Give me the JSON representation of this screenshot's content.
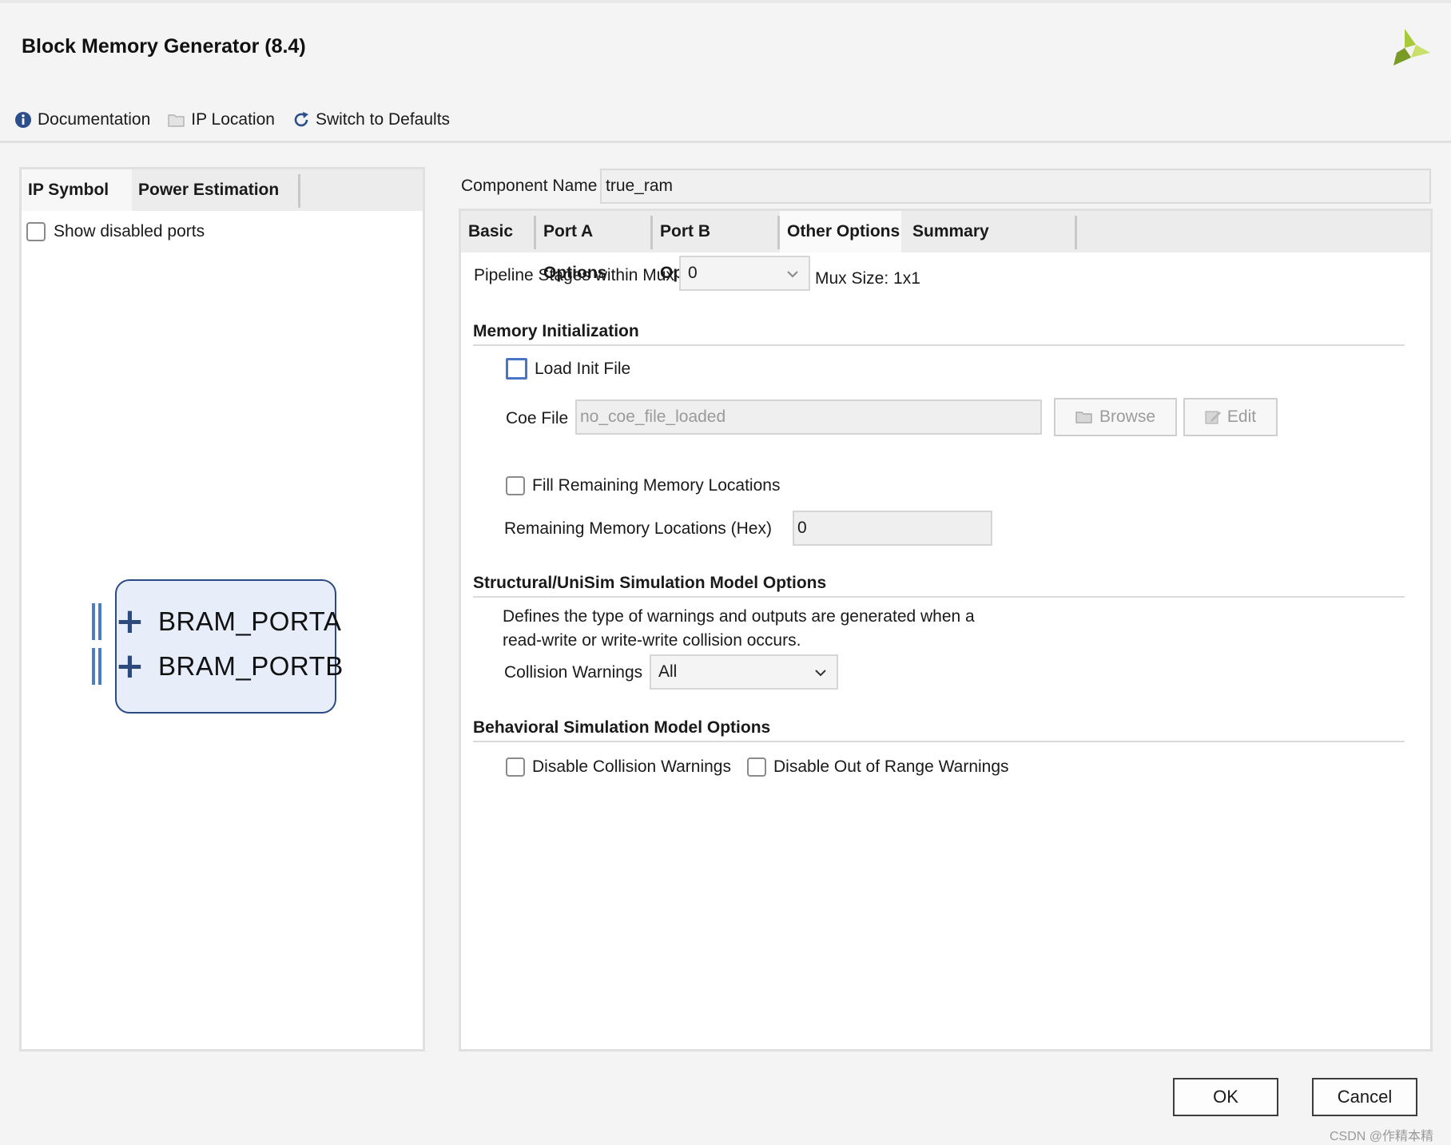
{
  "window": {
    "title": "Block Memory Generator (8.4)"
  },
  "toolbar": {
    "documentation": "Documentation",
    "ip_location": "IP Location",
    "switch_defaults": "Switch to Defaults"
  },
  "left_panel": {
    "tabs": [
      "IP Symbol",
      "Power Estimation"
    ],
    "show_disabled_ports": "Show disabled ports",
    "ports": [
      "BRAM_PORTA",
      "BRAM_PORTB"
    ]
  },
  "component": {
    "label": "Component Name",
    "value": "true_ram"
  },
  "right_tabs": [
    "Basic",
    "Port A Options",
    "Port B Options",
    "Other Options",
    "Summary"
  ],
  "pipeline": {
    "label": "Pipeline Stages within Mux",
    "value": "0",
    "mux_size": "Mux Size: 1x1"
  },
  "memory_init": {
    "heading": "Memory Initialization",
    "load_init": "Load Init File",
    "coe_label": "Coe File",
    "coe_value": "no_coe_file_loaded",
    "browse": "Browse",
    "edit": "Edit",
    "fill_remaining": "Fill Remaining Memory Locations",
    "remaining_label": "Remaining Memory Locations (Hex)",
    "remaining_value": "0"
  },
  "structural": {
    "heading": "Structural/UniSim Simulation Model Options",
    "desc_line1": "Defines the type of warnings and outputs are generated when a",
    "desc_line2": "read-write or write-write collision occurs.",
    "collision_label": "Collision Warnings",
    "collision_value": "All"
  },
  "behavioral": {
    "heading": "Behavioral Simulation Model Options",
    "disable_collision": "Disable Collision Warnings",
    "disable_range": "Disable Out of Range Warnings"
  },
  "footer": {
    "ok": "OK",
    "cancel": "Cancel"
  },
  "watermark": "CSDN @作精本精",
  "colors": {
    "accent": "#4a74c4",
    "symbol_fill": "#e7eefa",
    "symbol_border": "#2b4a86",
    "logo": "#8cb833"
  }
}
